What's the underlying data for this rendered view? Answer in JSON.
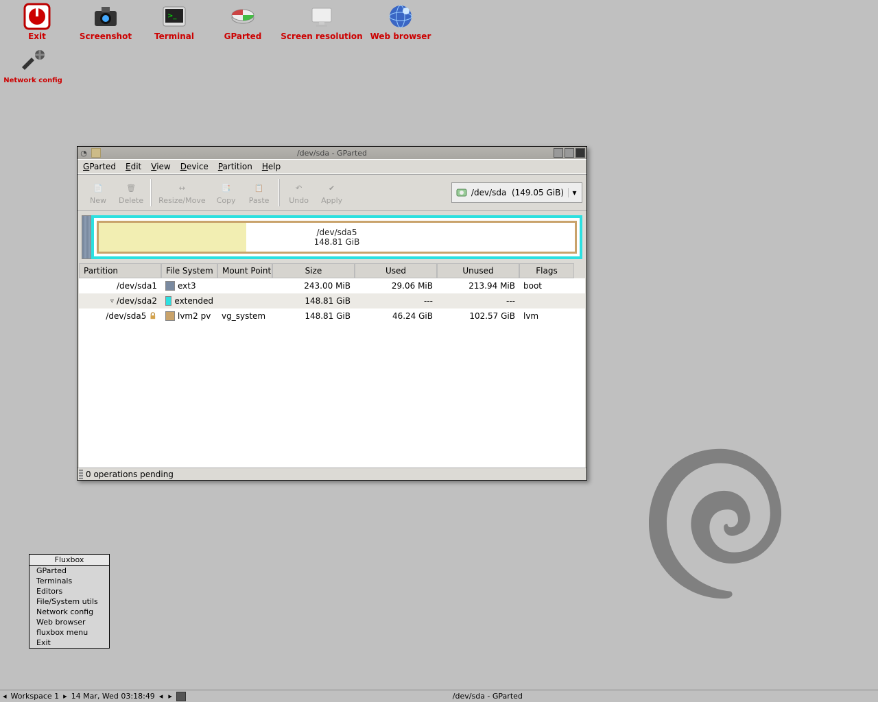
{
  "desktop": {
    "icons": [
      {
        "label": "Exit",
        "icon": "power-icon"
      },
      {
        "label": "Screenshot",
        "icon": "camera-icon"
      },
      {
        "label": "Terminal",
        "icon": "terminal-icon"
      },
      {
        "label": "GParted",
        "icon": "gparted-icon"
      },
      {
        "label": "Screen resolution",
        "icon": "display-icon"
      },
      {
        "label": "Web browser",
        "icon": "globe-icon"
      }
    ],
    "icons_row2": [
      {
        "label": "Network config",
        "icon": "wrench-icon"
      }
    ]
  },
  "fluxbox_menu": {
    "title": "Fluxbox",
    "items": [
      "GParted",
      "Terminals",
      "Editors",
      "File/System utils",
      "Network config",
      "Web browser",
      "fluxbox menu",
      "Exit"
    ]
  },
  "taskbar": {
    "workspace": "Workspace 1",
    "clock": "14 Mar, Wed 03:18:49",
    "active_window": "/dev/sda - GParted"
  },
  "gparted": {
    "title": "/dev/sda - GParted",
    "menu": [
      "GParted",
      "Edit",
      "View",
      "Device",
      "Partition",
      "Help"
    ],
    "toolbar": [
      "New",
      "Delete",
      "Resize/Move",
      "Copy",
      "Paste",
      "Undo",
      "Apply"
    ],
    "device_selector": {
      "device": "/dev/sda",
      "size": "(149.05 GiB)"
    },
    "graphic": {
      "label_top": "/dev/sda5",
      "label_bottom": "148.81 GiB",
      "used_fraction": 0.31
    },
    "columns": [
      "Partition",
      "File System",
      "Mount Point",
      "Size",
      "Used",
      "Unused",
      "Flags"
    ],
    "rows": [
      {
        "indent": 0,
        "expander": "",
        "name": "/dev/sda1",
        "lock": false,
        "fs_color": "sw-ext3",
        "fs": "ext3",
        "mount": "",
        "size": "243.00 MiB",
        "used": "29.06 MiB",
        "unused": "213.94 MiB",
        "flags": "boot"
      },
      {
        "indent": 0,
        "expander": "▿",
        "name": "/dev/sda2",
        "lock": false,
        "fs_color": "sw-extended",
        "fs": "extended",
        "mount": "",
        "size": "148.81 GiB",
        "used": "---",
        "unused": "---",
        "flags": ""
      },
      {
        "indent": 1,
        "expander": "",
        "name": "/dev/sda5",
        "lock": true,
        "fs_color": "sw-lvm",
        "fs": "lvm2 pv",
        "mount": "vg_system",
        "size": "148.81 GiB",
        "used": "46.24 GiB",
        "unused": "102.57 GiB",
        "flags": "lvm"
      }
    ],
    "status": "0 operations pending"
  }
}
